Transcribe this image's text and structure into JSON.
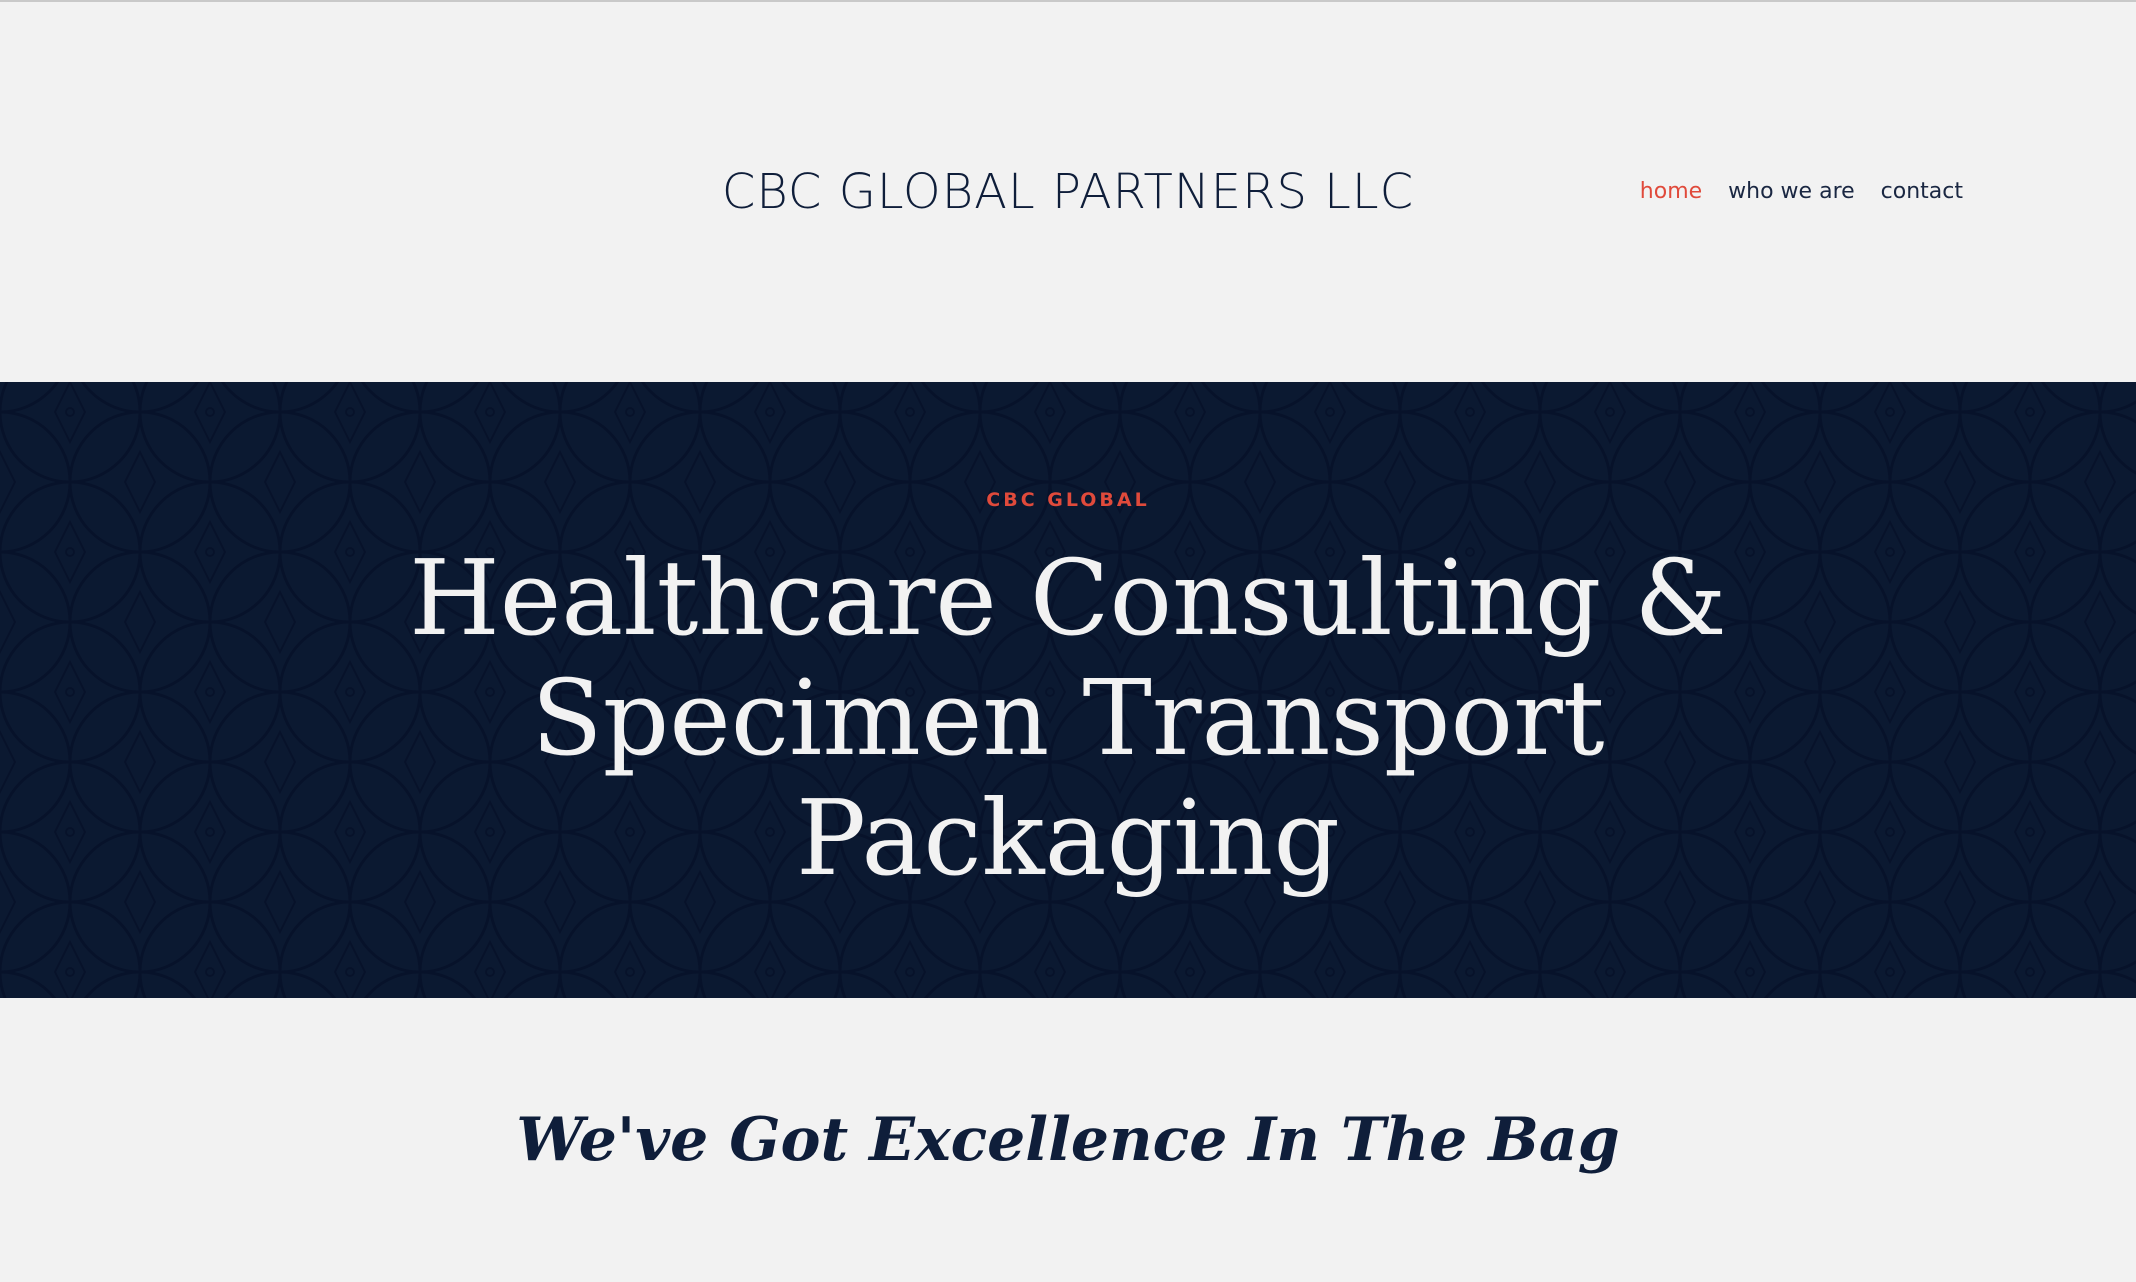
{
  "header": {
    "site_title": "CBC GLOBAL PARTNERS LLC",
    "nav": [
      {
        "label": "home",
        "active": true
      },
      {
        "label": "who we are",
        "active": false
      },
      {
        "label": "contact",
        "active": false
      }
    ]
  },
  "hero": {
    "kicker": "CBC GLOBAL",
    "heading": "Healthcare Consulting & Specimen Transport Packaging"
  },
  "main": {
    "tagline": "We've Got Excellence In The Bag"
  },
  "colors": {
    "accent": "#e04a3b",
    "navy": "#0b1931",
    "background": "#f2f2f2",
    "text_dark": "#0f1e3a"
  }
}
